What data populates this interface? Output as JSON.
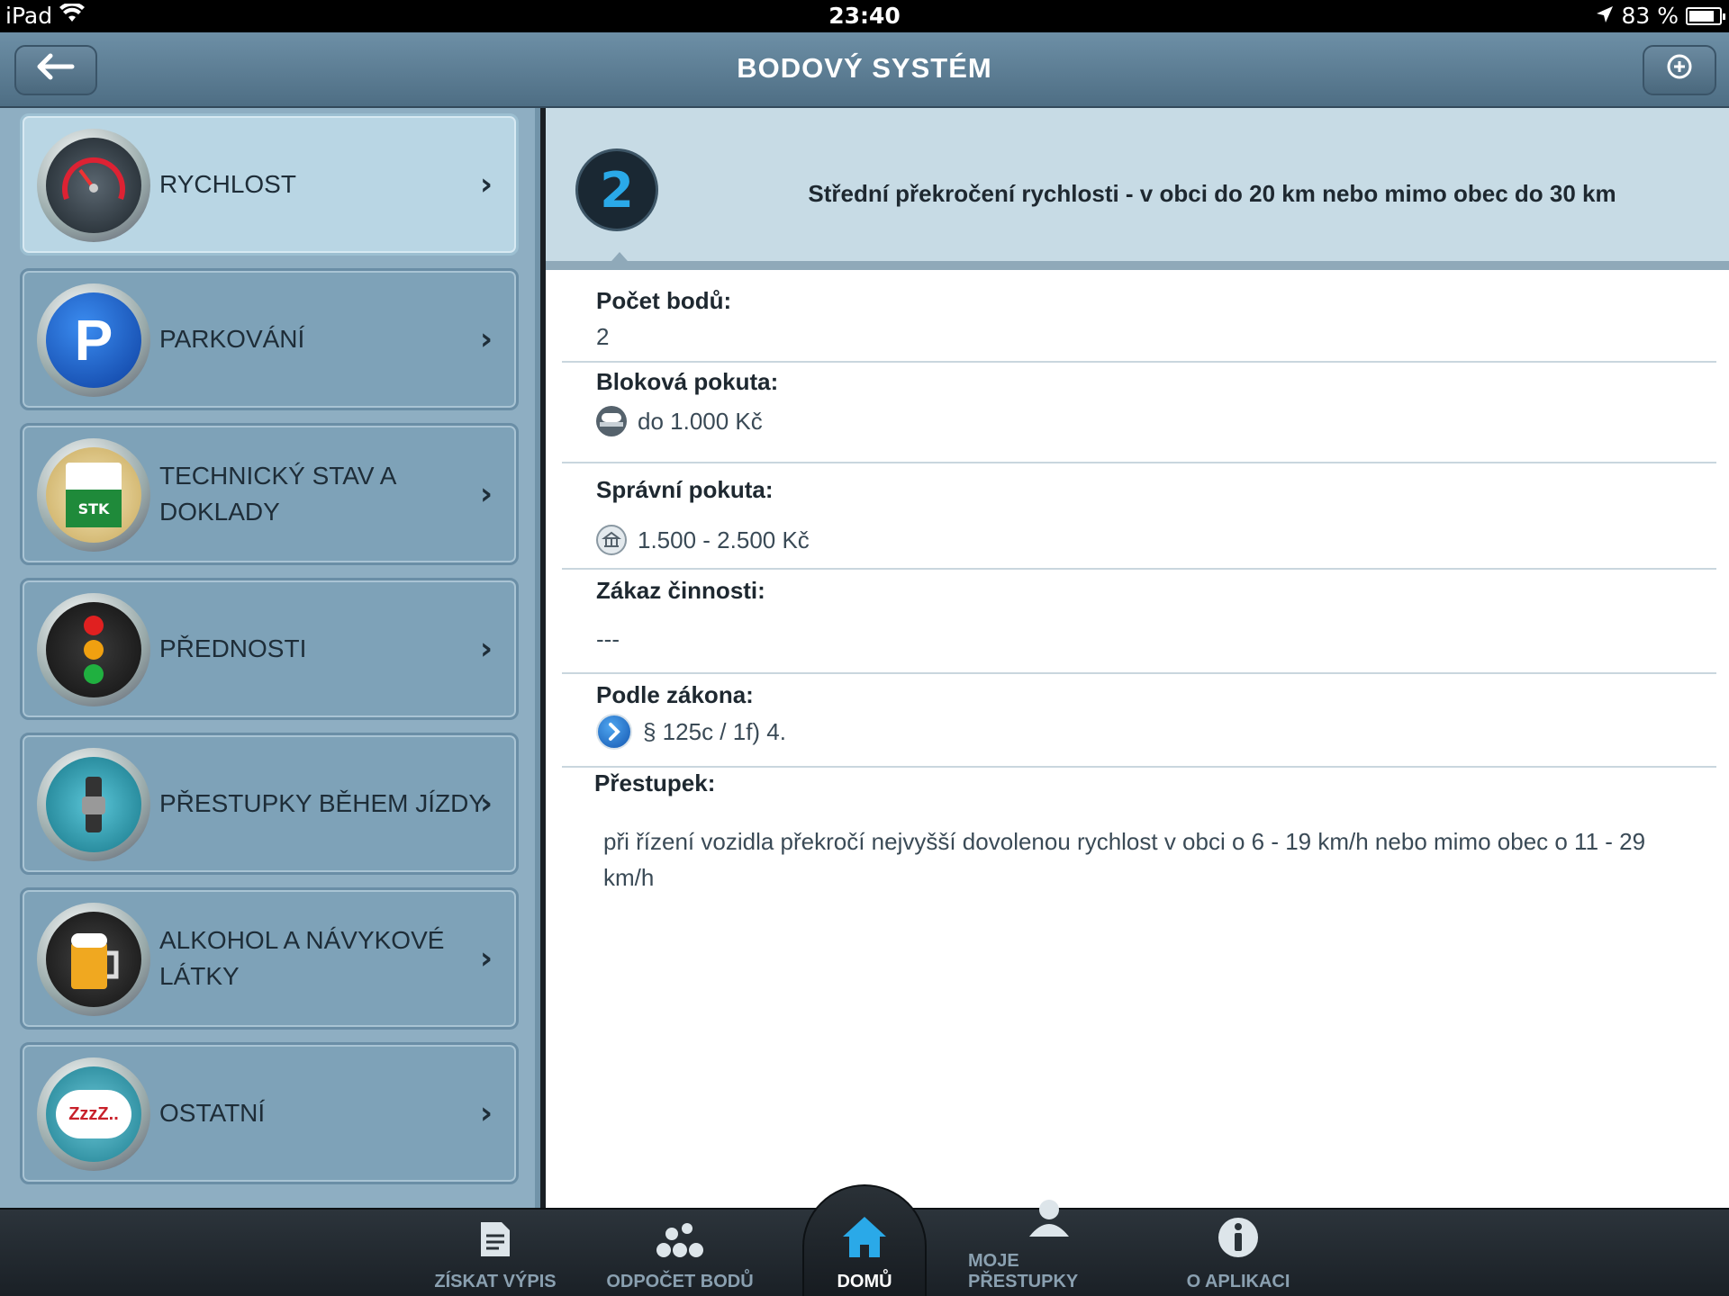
{
  "status": {
    "device": "iPad",
    "time": "23:40",
    "battery": "83 %",
    "battery_level": 0.83
  },
  "nav": {
    "title": "BODOVÝ SYSTÉM"
  },
  "categories": [
    {
      "label": "RYCHLOST",
      "icon": "speedometer-icon",
      "active": true
    },
    {
      "label": "PARKOVÁNÍ",
      "icon": "parking-icon",
      "active": false
    },
    {
      "label": "TECHNICKÝ STAV A DOKLADY",
      "icon": "stk-document-icon",
      "active": false
    },
    {
      "label": "PŘEDNOSTI",
      "icon": "traffic-light-icon",
      "active": false
    },
    {
      "label": "PŘESTUPKY BĚHEM JÍZDY",
      "icon": "seatbelt-icon",
      "active": false
    },
    {
      "label": "ALKOHOL A NÁVYKOVÉ LÁTKY",
      "icon": "beer-icon",
      "active": false
    },
    {
      "label": "OSTATNÍ",
      "icon": "sleep-bubble-icon",
      "active": false
    }
  ],
  "stk_text": "STK",
  "sleep_text": "ZzzZ..",
  "detail": {
    "points": "2",
    "title": "Střední překročení rychlosti - v obci do 20 km nebo mimo obec do 30 km",
    "points_label": "Počet bodů:",
    "points_value": "2",
    "block_fine_label": "Bloková pokuta:",
    "block_fine_value": "do 1.000 Kč",
    "admin_fine_label": "Správní pokuta:",
    "admin_fine_value": "1.500 - 2.500 Kč",
    "ban_label": "Zákaz činnosti:",
    "ban_value": "---",
    "law_label": "Podle zákona:",
    "law_value": "§ 125c / 1f) 4.",
    "offense_label": "Přestupek:",
    "offense_value": "při řízení vozidla překročí nejvyšší dovolenou rychlost v obci o 6 - 19 km/h nebo mimo obec o 11 - 29 km/h"
  },
  "tabs": [
    {
      "label": "ZÍSKAT VÝPIS",
      "icon": "document-icon"
    },
    {
      "label": "ODPOČET BODŮ",
      "icon": "points-icon"
    },
    {
      "label": "DOMŮ",
      "icon": "home-icon",
      "active": true
    },
    {
      "label": "MOJE PŘESTUPKY",
      "icon": "user-icon"
    },
    {
      "label": "O APLIKACI",
      "icon": "info-icon"
    }
  ]
}
